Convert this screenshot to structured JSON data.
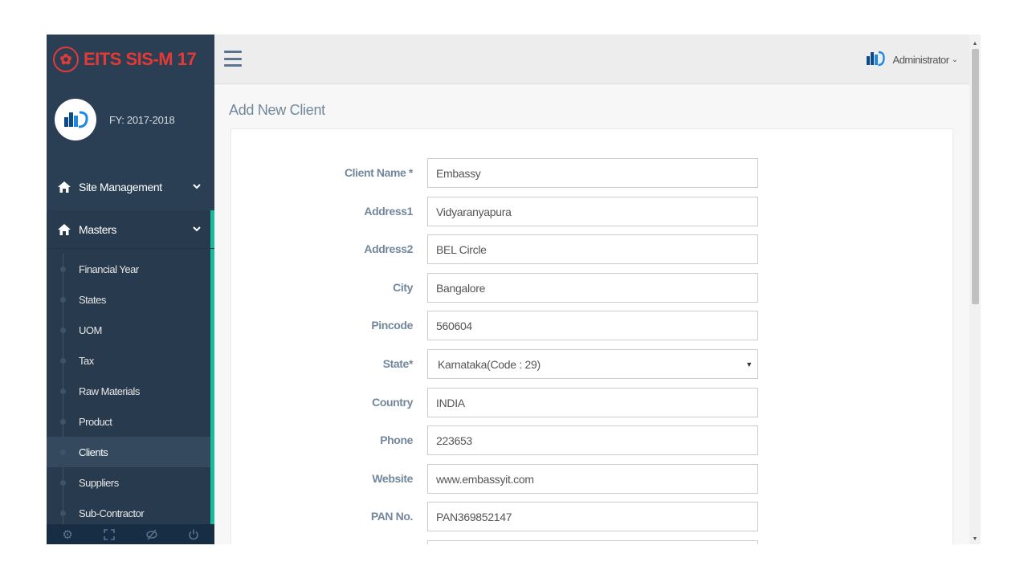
{
  "brand": {
    "title": "EITS SIS-M 17"
  },
  "profile": {
    "fy": "FY: 2017-2018"
  },
  "sidebar": {
    "site_management": "Site Management",
    "masters": "Masters",
    "submenu": [
      "Financial Year",
      "States",
      "UOM",
      "Tax",
      "Raw Materials",
      "Product",
      "Clients",
      "Suppliers",
      "Sub-Contractor"
    ],
    "active": "Clients"
  },
  "topbar": {
    "user": "Administrator"
  },
  "page": {
    "title": "Add New Client"
  },
  "form": {
    "client_name": {
      "label": "Client Name *",
      "value": "Embassy"
    },
    "address1": {
      "label": "Address1",
      "value": "Vidyaranyapura"
    },
    "address2": {
      "label": "Address2",
      "value": "BEL Circle"
    },
    "city": {
      "label": "City",
      "value": "Bangalore"
    },
    "pincode": {
      "label": "Pincode",
      "value": "560604"
    },
    "state": {
      "label": "State*",
      "value": "Karnataka(Code : 29)"
    },
    "country": {
      "label": "Country",
      "value": "INDIA"
    },
    "phone": {
      "label": "Phone",
      "value": "223653"
    },
    "website": {
      "label": "Website",
      "value": "www.embassyit.com"
    },
    "pan": {
      "label": "PAN No.",
      "value": "PAN369852147"
    }
  },
  "colors": {
    "sidebar": "#2a3f54",
    "accent": "#1abb9c",
    "brand": "#e53935"
  }
}
